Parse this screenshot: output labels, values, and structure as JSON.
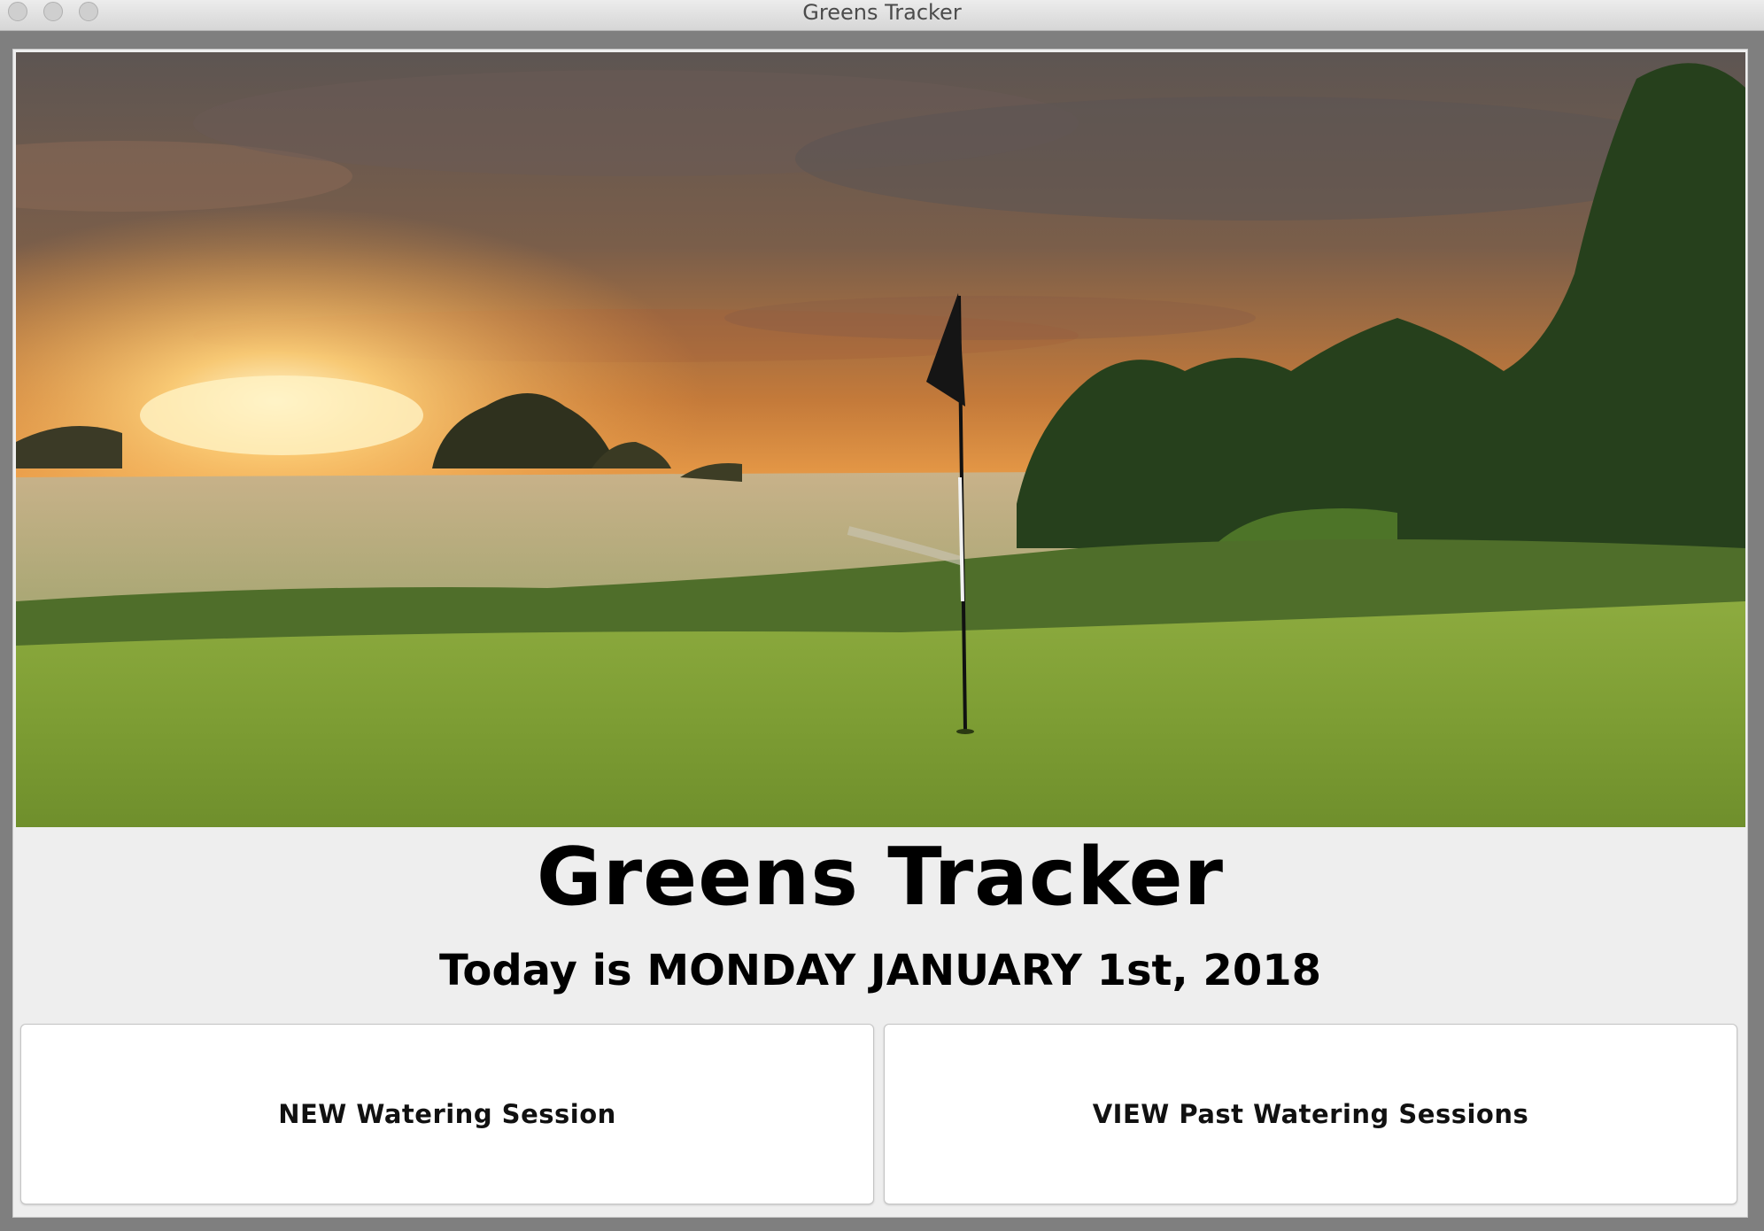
{
  "window": {
    "title": "Greens Tracker"
  },
  "hero_image": {
    "description_icon": "golf-course-sunset-photo"
  },
  "main": {
    "app_title": "Greens Tracker",
    "date_text": "Today is MONDAY JANUARY 1st, 2018"
  },
  "actions": {
    "new_session_label": "NEW Watering Session",
    "view_sessions_label": "VIEW Past Watering Sessions"
  },
  "colors": {
    "window_background": "#7f7f7f",
    "panel_background": "#eeeeee",
    "button_background": "#ffffff"
  }
}
